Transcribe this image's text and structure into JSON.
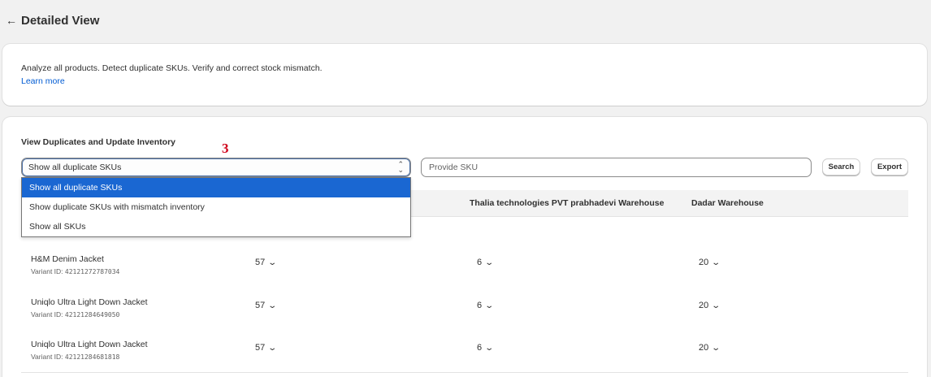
{
  "header": {
    "title": "Detailed View",
    "back_icon": "arrow-left-icon"
  },
  "intro": {
    "description": "Analyze all products. Detect duplicate SKUs. Verify and correct stock mismatch.",
    "learn_more": "Learn more"
  },
  "section": {
    "title": "View Duplicates and Update Inventory",
    "marker": "3",
    "filter": {
      "selected": "Show all duplicate SKUs",
      "options": [
        "Show all duplicate SKUs",
        "Show duplicate SKUs with mismatch inventory",
        "Show all SKUs"
      ]
    },
    "sku_input": {
      "placeholder": "Provide SKU",
      "value": ""
    },
    "search_label": "Search",
    "export_label": "Export"
  },
  "table": {
    "columns": [
      "Thalia technologies PVT prabhadevi Warehouse",
      "Dadar Warehouse"
    ],
    "rows": [
      {
        "name": "H&M Denim Jacket",
        "variant_label": "Variant ID:",
        "variant_id": "42121272787034",
        "qty": [
          "57",
          "6",
          "20"
        ]
      },
      {
        "name": "Uniqlo Ultra Light Down Jacket",
        "variant_label": "Variant ID:",
        "variant_id": "42121284649050",
        "qty": [
          "57",
          "6",
          "20"
        ]
      },
      {
        "name": "Uniqlo Ultra Light Down Jacket",
        "variant_label": "Variant ID:",
        "variant_id": "42121284681818",
        "qty": [
          "57",
          "6",
          "20"
        ]
      }
    ]
  },
  "colors": {
    "accent": "#1a67d2",
    "link": "#005bd3",
    "marker": "#d0021b"
  }
}
